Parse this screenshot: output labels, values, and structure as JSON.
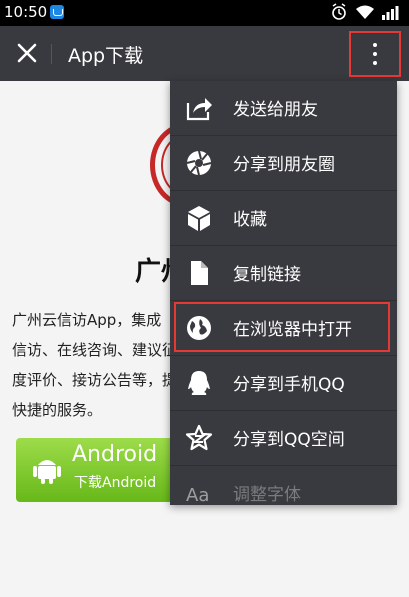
{
  "status": {
    "time": "10:50"
  },
  "titlebar": {
    "title": "App下载"
  },
  "content": {
    "heading": "广州",
    "description": "  广州云信访App，集成\n信访、在线咨询、建议征\n度评价、接访公告等，提\n快捷的服务。",
    "android_button": {
      "title": "Android",
      "subtitle": "下载Android"
    }
  },
  "menu": {
    "items": [
      {
        "label": "发送给朋友",
        "icon": "share-arrow-icon"
      },
      {
        "label": "分享到朋友圈",
        "icon": "moments-aperture-icon"
      },
      {
        "label": "收藏",
        "icon": "cube-favorite-icon"
      },
      {
        "label": "复制链接",
        "icon": "copy-document-icon"
      },
      {
        "label": "在浏览器中打开",
        "icon": "globe-icon"
      },
      {
        "label": "分享到手机QQ",
        "icon": "qq-penguin-icon"
      },
      {
        "label": "分享到QQ空间",
        "icon": "qzone-star-icon"
      },
      {
        "label": "调整字体",
        "icon": "font-size-icon"
      }
    ]
  },
  "colors": {
    "titlebar": "#393a3f",
    "menu": "#393a3f",
    "highlight": "#e53935",
    "android": "#7bc52a"
  }
}
